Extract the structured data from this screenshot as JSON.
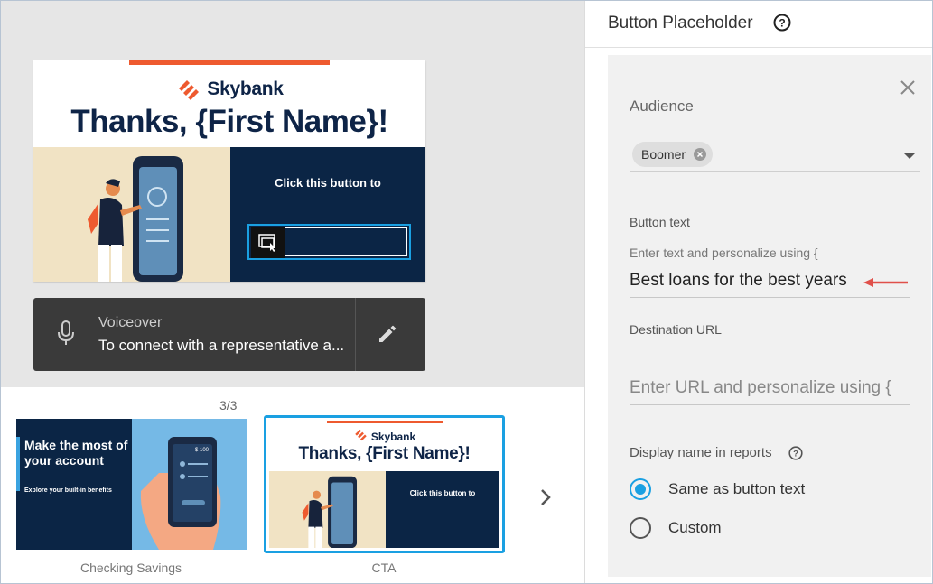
{
  "preview": {
    "slide": {
      "brand": "Skybank",
      "title": "Thanks, {First Name}!",
      "cta_text": "Click this button to"
    },
    "voiceover": {
      "label": "Voiceover",
      "text": "To connect with a representative a..."
    }
  },
  "filmstrip": {
    "counter": "3/3",
    "thumbs": [
      {
        "label": "Checking Savings",
        "headline": "Make the most of your account",
        "subtext": "Explore your built-in benefits",
        "phone_amount": "$ 100"
      },
      {
        "label": "CTA",
        "brand": "Skybank",
        "title": "Thanks, {First Name}!",
        "cta_text": "Click this button to"
      }
    ]
  },
  "panel": {
    "title": "Button Placeholder",
    "audience_label": "Audience",
    "audience_chip": "Boomer",
    "button_text_label": "Button text",
    "button_text_hint": "Enter text and personalize using {",
    "button_text_value": "Best loans for the best years",
    "destination_label": "Destination URL",
    "destination_placeholder": "Enter URL and personalize using {",
    "display_name_label": "Display name in reports",
    "radio_options": [
      "Same as button text",
      "Custom"
    ]
  },
  "colors": {
    "accent": "#1aa0e2",
    "brand_orange": "#ee5a2f",
    "navy": "#0b2545",
    "arrow_red": "#e0504a"
  }
}
